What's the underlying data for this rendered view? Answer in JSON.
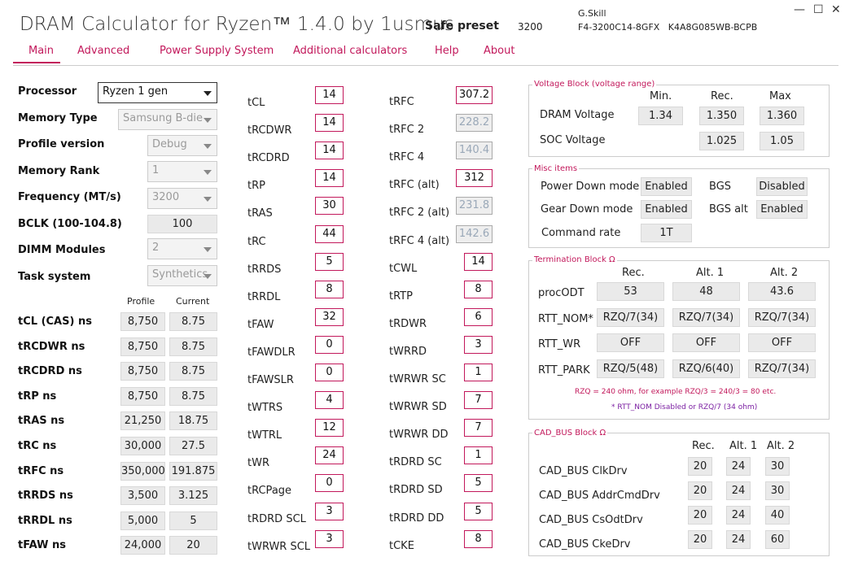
{
  "header": {
    "title": "DRAM Calculator for Ryzen™ 1.4.0 by 1usmus",
    "preset": "Safe preset",
    "frequency": "3200",
    "manufacturer": "G.Skill",
    "part_number": "F4-3200C14-8GFX   K4A8G085WB-BCPB"
  },
  "window": {
    "minimize": "—",
    "maximize": "☐",
    "close": "✕"
  },
  "tabs": [
    "Main",
    "Advanced",
    "Power Supply System",
    "Additional calculators",
    "Help",
    "About"
  ],
  "settings": {
    "processor": {
      "label": "Processor",
      "value": "Ryzen 1 gen"
    },
    "memory_type": {
      "label": "Memory Type",
      "value": "Samsung B-die"
    },
    "profile_version": {
      "label": "Profile version",
      "value": "Debug"
    },
    "memory_rank": {
      "label": "Memory Rank",
      "value": "1"
    },
    "frequency": {
      "label": "Frequency (MT/s)",
      "value": "3200"
    },
    "bclk": {
      "label": "BCLK (100-104.8)",
      "value": "100"
    },
    "dimm_modules": {
      "label": "DIMM Modules",
      "value": "2"
    },
    "task_system": {
      "label": "Task system",
      "value": "Synthetics"
    }
  },
  "ns_table": {
    "headers": [
      "Profile",
      "Current"
    ],
    "rows": [
      {
        "label": "tCL (CAS) ns",
        "profile": "8,750",
        "current": "8.75"
      },
      {
        "label": "tRCDWR ns",
        "profile": "8,750",
        "current": "8.75"
      },
      {
        "label": "tRCDRD ns",
        "profile": "8,750",
        "current": "8.75"
      },
      {
        "label": "tRP ns",
        "profile": "8,750",
        "current": "8.75"
      },
      {
        "label": "tRAS ns",
        "profile": "21,250",
        "current": "18.75"
      },
      {
        "label": "tRC ns",
        "profile": "30,000",
        "current": "27.5"
      },
      {
        "label": "tRFC ns",
        "profile": "350,000",
        "current": "191.875"
      },
      {
        "label": "tRRDS ns",
        "profile": "3,500",
        "current": "3.125"
      },
      {
        "label": "tRRDL ns",
        "profile": "5,000",
        "current": "5"
      },
      {
        "label": "tFAW ns",
        "profile": "24,000",
        "current": "20"
      }
    ]
  },
  "timings_col1": [
    {
      "label": "tCL",
      "value": "14"
    },
    {
      "label": "tRCDWR",
      "value": "14"
    },
    {
      "label": "tRCDRD",
      "value": "14"
    },
    {
      "label": "tRP",
      "value": "14"
    },
    {
      "label": "tRAS",
      "value": "30"
    },
    {
      "label": "tRC",
      "value": "44"
    },
    {
      "label": "tRRDS",
      "value": "5"
    },
    {
      "label": "tRRDL",
      "value": "8"
    },
    {
      "label": "tFAW",
      "value": "32"
    },
    {
      "label": "tFAWDLR",
      "value": "0"
    },
    {
      "label": "tFAWSLR",
      "value": "0"
    },
    {
      "label": "tWTRS",
      "value": "4"
    },
    {
      "label": "tWTRL",
      "value": "12"
    },
    {
      "label": "tWR",
      "value": "24"
    },
    {
      "label": "tRCPage",
      "value": "0"
    },
    {
      "label": "tRDRD SCL",
      "value": "3"
    },
    {
      "label": "tWRWR SCL",
      "value": "3"
    }
  ],
  "timings_col2": [
    {
      "label": "tRFC",
      "value": "307.2",
      "disabled": false
    },
    {
      "label": "tRFC 2",
      "value": "228.2",
      "disabled": true
    },
    {
      "label": "tRFC 4",
      "value": "140.4",
      "disabled": true
    },
    {
      "label": "tRFC (alt)",
      "value": "312",
      "disabled": false
    },
    {
      "label": "tRFC 2 (alt)",
      "value": "231.8",
      "disabled": true
    },
    {
      "label": "tRFC 4 (alt)",
      "value": "142.6",
      "disabled": true
    },
    {
      "label": "tCWL",
      "value": "14",
      "disabled": false
    },
    {
      "label": "tRTP",
      "value": "8",
      "disabled": false
    },
    {
      "label": "tRDWR",
      "value": "6",
      "disabled": false
    },
    {
      "label": "tWRRD",
      "value": "3",
      "disabled": false
    },
    {
      "label": "tWRWR SC",
      "value": "1",
      "disabled": false
    },
    {
      "label": "tWRWR SD",
      "value": "7",
      "disabled": false
    },
    {
      "label": "tWRWR DD",
      "value": "7",
      "disabled": false
    },
    {
      "label": "tRDRD SC",
      "value": "1",
      "disabled": false
    },
    {
      "label": "tRDRD SD",
      "value": "5",
      "disabled": false
    },
    {
      "label": "tRDRD DD",
      "value": "5",
      "disabled": false
    },
    {
      "label": "tCKE",
      "value": "8",
      "disabled": false
    }
  ],
  "voltage": {
    "title": "Voltage Block (voltage range)",
    "headers": [
      "Min.",
      "Rec.",
      "Max"
    ],
    "dram": {
      "label": "DRAM Voltage",
      "min": "1.34",
      "rec": "1.350",
      "max": "1.360"
    },
    "soc": {
      "label": "SOC Voltage",
      "rec": "1.025",
      "max": "1.05"
    }
  },
  "misc": {
    "title": "Misc items",
    "power_down": {
      "label": "Power Down mode",
      "value": "Enabled"
    },
    "gear_down": {
      "label": "Gear Down mode",
      "value": "Enabled"
    },
    "command_rate": {
      "label": "Command rate",
      "value": "1T"
    },
    "bgs": {
      "label": "BGS",
      "value": "Disabled"
    },
    "bgs_alt": {
      "label": "BGS alt",
      "value": "Enabled"
    }
  },
  "termination": {
    "title": "Termination Block Ω",
    "headers": [
      "Rec.",
      "Alt. 1",
      "Alt. 2"
    ],
    "rows": [
      {
        "label": "procODT",
        "values": [
          "53",
          "48",
          "43.6"
        ]
      },
      {
        "label": "RTT_NOM*",
        "values": [
          "RZQ/7(34)",
          "RZQ/7(34)",
          "RZQ/7(34)"
        ]
      },
      {
        "label": "RTT_WR",
        "values": [
          "OFF",
          "OFF",
          "OFF"
        ]
      },
      {
        "label": "RTT_PARK",
        "values": [
          "RZQ/5(48)",
          "RZQ/6(40)",
          "RZQ/7(34)"
        ]
      }
    ],
    "note1": "RZQ = 240 ohm, for example RZQ/3 = 240/3 = 80 etc.",
    "note2": "* RTT_NOM Disabled or RZQ/7 (34 ohm)"
  },
  "cad_bus": {
    "title": "CAD_BUS Block Ω",
    "headers": [
      "Rec.",
      "Alt. 1",
      "Alt. 2"
    ],
    "rows": [
      {
        "label": "CAD_BUS ClkDrv",
        "values": [
          "20",
          "24",
          "30"
        ]
      },
      {
        "label": "CAD_BUS AddrCmdDrv",
        "values": [
          "20",
          "24",
          "30"
        ]
      },
      {
        "label": "CAD_BUS CsOdtDrv",
        "values": [
          "20",
          "24",
          "40"
        ]
      },
      {
        "label": "CAD_BUS CkeDrv",
        "values": [
          "20",
          "24",
          "60"
        ]
      }
    ]
  }
}
